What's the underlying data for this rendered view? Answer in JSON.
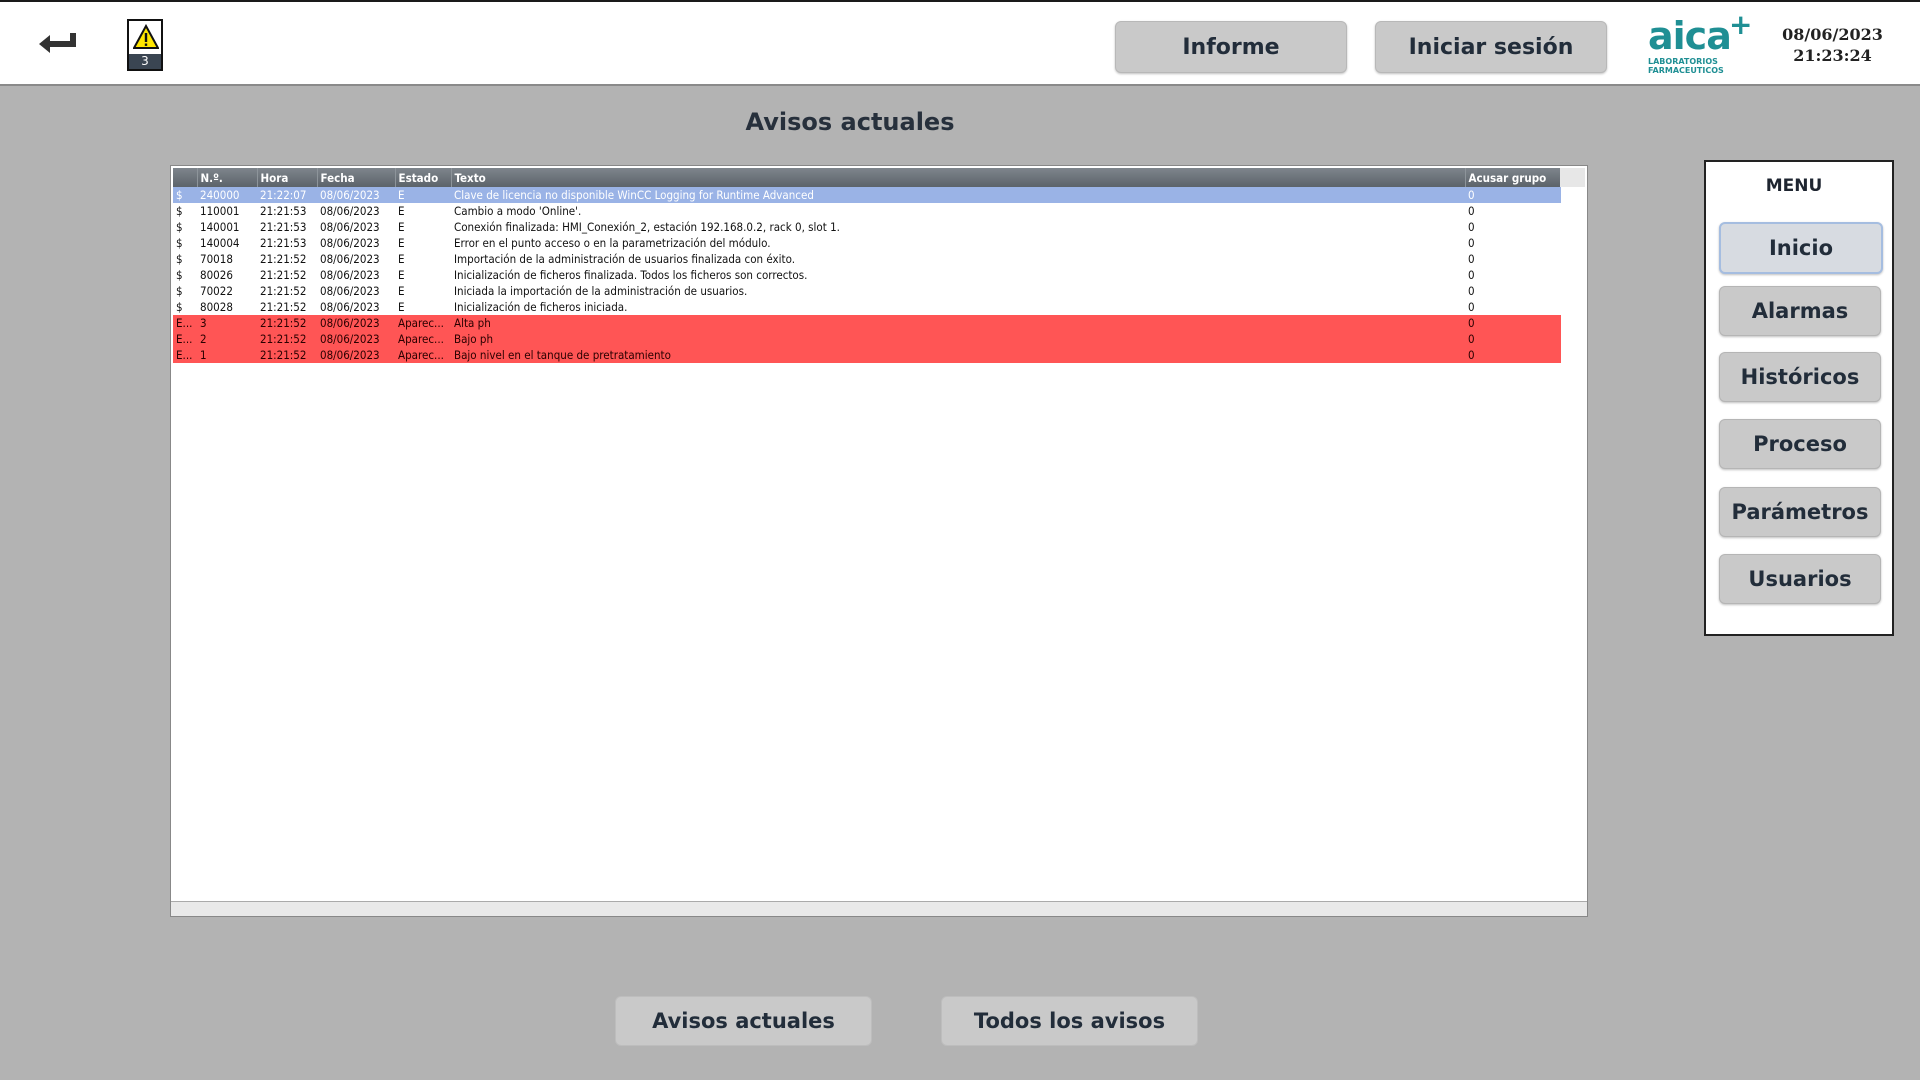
{
  "header": {
    "alarm_count": "3",
    "report_button": "Informe",
    "login_button": "Iniciar sesión",
    "logo_text": "aica",
    "logo_subtitle_1": "LABORATORIOS",
    "logo_subtitle_2": "FARMACEUTICOS",
    "date": "08/06/2023",
    "time": "21:23:24"
  },
  "page": {
    "title": "Avisos actuales"
  },
  "alarm_table": {
    "columns": [
      "",
      "N.º.",
      "Hora",
      "Fecha",
      "Estado",
      "Texto",
      "Acusar grupo"
    ],
    "rows": [
      {
        "cls": "$",
        "num": "240000",
        "hora": "21:22:07",
        "fecha": "08/06/2023",
        "estado": "E",
        "texto": "Clave de licencia no disponible WinCC Logging for Runtime Advanced",
        "grupo": "0",
        "state": "selected"
      },
      {
        "cls": "$",
        "num": "110001",
        "hora": "21:21:53",
        "fecha": "08/06/2023",
        "estado": "E",
        "texto": "Cambio a modo 'Online'.",
        "grupo": "0",
        "state": "normal"
      },
      {
        "cls": "$",
        "num": "140001",
        "hora": "21:21:53",
        "fecha": "08/06/2023",
        "estado": "E",
        "texto": "Conexión finalizada: HMI_Conexión_2, estación 192.168.0.2, rack 0, slot 1.",
        "grupo": "0",
        "state": "normal"
      },
      {
        "cls": "$",
        "num": "140004",
        "hora": "21:21:53",
        "fecha": "08/06/2023",
        "estado": "E",
        "texto": "Error en el punto acceso o en la parametrización del módulo.",
        "grupo": "0",
        "state": "normal"
      },
      {
        "cls": "$",
        "num": "70018",
        "hora": "21:21:52",
        "fecha": "08/06/2023",
        "estado": "E",
        "texto": "Importación de la administración de usuarios finalizada con éxito.",
        "grupo": "0",
        "state": "normal"
      },
      {
        "cls": "$",
        "num": "80026",
        "hora": "21:21:52",
        "fecha": "08/06/2023",
        "estado": "E",
        "texto": "Inicialización de ficheros finalizada. Todos los ficheros son correctos.",
        "grupo": "0",
        "state": "normal"
      },
      {
        "cls": "$",
        "num": "70022",
        "hora": "21:21:52",
        "fecha": "08/06/2023",
        "estado": "E",
        "texto": "Iniciada la importación de la administración de usuarios.",
        "grupo": "0",
        "state": "normal"
      },
      {
        "cls": "$",
        "num": "80028",
        "hora": "21:21:52",
        "fecha": "08/06/2023",
        "estado": "E",
        "texto": "Inicialización de ficheros iniciada.",
        "grupo": "0",
        "state": "normal"
      },
      {
        "cls": "E...",
        "num": "3",
        "hora": "21:21:52",
        "fecha": "08/06/2023",
        "estado": "Aparec...",
        "texto": "Alta ph",
        "grupo": "0",
        "state": "alarm"
      },
      {
        "cls": "E...",
        "num": "2",
        "hora": "21:21:52",
        "fecha": "08/06/2023",
        "estado": "Aparec...",
        "texto": "Bajo ph",
        "grupo": "0",
        "state": "alarm"
      },
      {
        "cls": "E...",
        "num": "1",
        "hora": "21:21:52",
        "fecha": "08/06/2023",
        "estado": "Aparec...",
        "texto": "Bajo nivel en el tanque de pretratamiento",
        "grupo": "0",
        "state": "alarm"
      }
    ]
  },
  "menu": {
    "title": "MENU",
    "items": [
      "Inicio",
      "Alarmas",
      "Históricos",
      "Proceso",
      "Parámetros",
      "Usuarios"
    ]
  },
  "bottom": {
    "current_button": "Avisos actuales",
    "all_button": "Todos los avisos"
  },
  "colors": {
    "background": "#b3b3b3",
    "selected_row": "#9ab3e6",
    "alarm_row": "#ff5555",
    "logo": "#1f8f94"
  }
}
